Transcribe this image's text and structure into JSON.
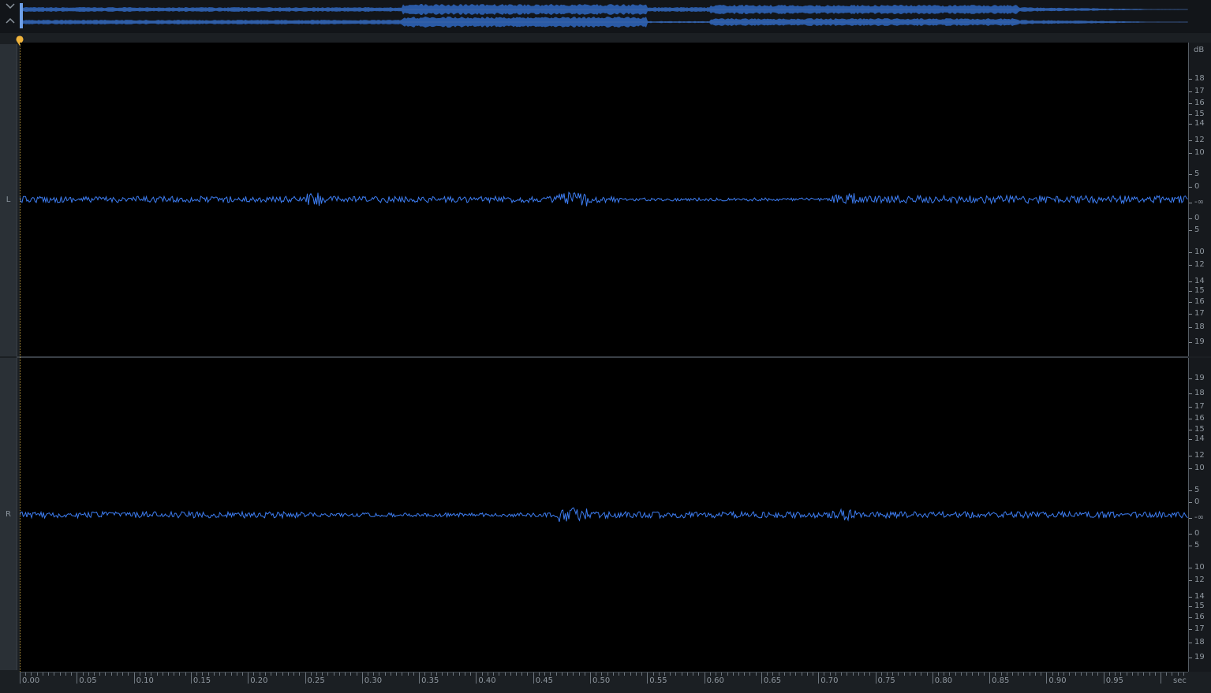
{
  "overview": {
    "collapse_icon": "chevron-down-icon",
    "expand_icon": "chevron-up-icon",
    "waveform_color": "#2a5aa6"
  },
  "channels": [
    {
      "label": "L"
    },
    {
      "label": "R"
    }
  ],
  "db_scale": {
    "unit": "dB",
    "upper_labels": [
      "18",
      "17",
      "16",
      "15",
      "14",
      "12",
      "10",
      "5",
      "0",
      "-∞",
      "0",
      "5",
      "10",
      "12",
      "14",
      "15",
      "16",
      "17",
      "18",
      "19"
    ],
    "lower_labels": [
      "19",
      "18",
      "17",
      "16",
      "15",
      "14",
      "12",
      "10",
      "5",
      "0",
      "-∞",
      "0",
      "5",
      "10",
      "12",
      "14",
      "15",
      "16",
      "17",
      "18",
      "19"
    ]
  },
  "time_ruler": {
    "unit": "sec",
    "labels": [
      "0.00",
      "0.05",
      "0.10",
      "0.15",
      "0.20",
      "0.25",
      "0.30",
      "0.35",
      "0.40",
      "0.45",
      "0.50",
      "0.55",
      "0.60",
      "0.65",
      "0.70",
      "0.75",
      "0.80",
      "0.85",
      "0.90",
      "0.95"
    ]
  },
  "colors": {
    "waveform": "#3d7df2",
    "playhead": "#f0b43c",
    "background": "#000000"
  }
}
